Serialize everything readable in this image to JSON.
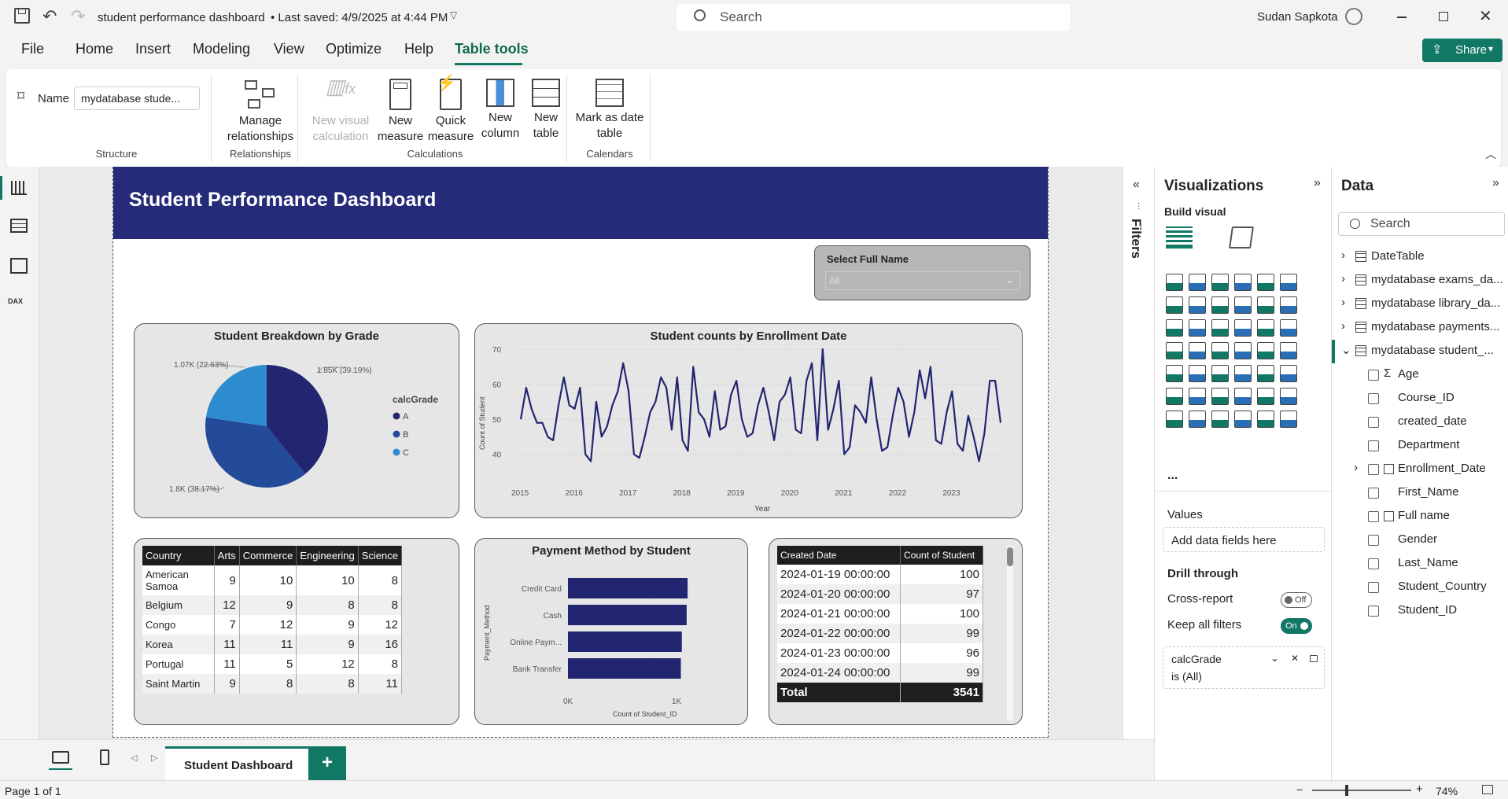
{
  "titlebar": {
    "file_title": "student performance dashboard",
    "saved_text": "• Last saved: 4/9/2025 at 4:44 PM",
    "search_placeholder": "Search",
    "user_name": "Sudan Sapkota",
    "share_label": "Share"
  },
  "menu": {
    "items": [
      "File",
      "Home",
      "Insert",
      "Modeling",
      "View",
      "Optimize",
      "Help",
      "Table tools"
    ],
    "active": "Table tools"
  },
  "ribbon": {
    "name_label": "Name",
    "name_value": "mydatabase stude...",
    "structure_label": "Structure",
    "manage_relationships": "Manage relationships",
    "relationships_label": "Relationships",
    "new_visual_calculation": "New visual calculation",
    "new_measure": "New measure",
    "quick_measure": "Quick measure",
    "new_column": "New column",
    "new_table": "New table",
    "calculations_label": "Calculations",
    "mark_as_date_table": "Mark as date table",
    "calendars_label": "Calendars"
  },
  "report": {
    "header_title": "Student Performance Dashboard",
    "slicer_title": "Select Full Name",
    "slicer_value": "All"
  },
  "pie": {
    "title": "Student Breakdown by Grade",
    "legend_title": "calcGrade",
    "label_a": "1.85K (39.19%)",
    "label_b": "1.8K (38.17%)",
    "label_c": "1.07K (22.63%)",
    "legend": [
      "A",
      "B",
      "C"
    ]
  },
  "line": {
    "title": "Student counts by Enrollment Date",
    "ylabel": "Count of Student",
    "xlabel": "Year",
    "yticks": [
      "70",
      "60",
      "50",
      "40"
    ],
    "xticks": [
      "2015",
      "2016",
      "2017",
      "2018",
      "2019",
      "2020",
      "2021",
      "2022",
      "2023"
    ]
  },
  "matrix": {
    "headers": [
      "Country",
      "Arts",
      "Commerce",
      "Engineering",
      "Science"
    ],
    "rows": [
      [
        "American Samoa",
        "9",
        "10",
        "10",
        "8"
      ],
      [
        "Belgium",
        "12",
        "9",
        "8",
        "8"
      ],
      [
        "Congo",
        "7",
        "12",
        "9",
        "12"
      ],
      [
        "Korea",
        "11",
        "11",
        "9",
        "16"
      ],
      [
        "Portugal",
        "11",
        "5",
        "12",
        "8"
      ],
      [
        "Saint Martin",
        "9",
        "8",
        "8",
        "11"
      ]
    ]
  },
  "bar": {
    "title": "Payment Method by Student",
    "ylabel": "Payment_Method",
    "xlabel": "Count of Student_ID",
    "xticks": [
      "0K",
      "1K"
    ]
  },
  "table": {
    "headers": [
      "Created Date",
      "Count of Student"
    ],
    "rows": [
      [
        "2024-01-19 00:00:00",
        "100"
      ],
      [
        "2024-01-20 00:00:00",
        "97"
      ],
      [
        "2024-01-21 00:00:00",
        "100"
      ],
      [
        "2024-01-22 00:00:00",
        "99"
      ],
      [
        "2024-01-23 00:00:00",
        "96"
      ],
      [
        "2024-01-24 00:00:00",
        "99"
      ]
    ],
    "total_label": "Total",
    "total_value": "3541"
  },
  "filters": {
    "label": "Filters"
  },
  "visualizations": {
    "title": "Visualizations",
    "build_visual": "Build visual",
    "values_label": "Values",
    "add_fields": "Add data fields here",
    "drill_through": "Drill through",
    "cross_report": "Cross-report",
    "cross_report_state": "Off",
    "keep_all_filters": "Keep all filters",
    "keep_all_filters_state": "On",
    "filter_card_field": "calcGrade",
    "filter_card_value": "is (All)",
    "more": "..."
  },
  "data_pane": {
    "title": "Data",
    "search_placeholder": "Search",
    "tables": [
      "DateTable",
      "mydatabase exams_da...",
      "mydatabase library_da...",
      "mydatabase payments...",
      "mydatabase student_..."
    ],
    "fields": [
      "Age",
      "Course_ID",
      "created_date",
      "Department",
      "Enrollment_Date",
      "First_Name",
      "Full name",
      "Gender",
      "Last_Name",
      "Student_Country",
      "Student_ID"
    ]
  },
  "tabs": {
    "page_tab": "Student Dashboard",
    "add": "+"
  },
  "status": {
    "page_info": "Page 1 of 1",
    "zoom": "74%"
  },
  "chart_data": [
    {
      "type": "pie",
      "title": "Student Breakdown by Grade",
      "legend_title": "calcGrade",
      "categories": [
        "A",
        "B",
        "C"
      ],
      "values": [
        1850,
        1800,
        1070
      ],
      "percents": [
        39.19,
        38.17,
        22.63
      ],
      "colors": [
        "#222670",
        "#244a9a",
        "#2d8ccf"
      ]
    },
    {
      "type": "line",
      "title": "Student counts by Enrollment Date",
      "ylabel": "Count of Student",
      "xlabel": "Year",
      "ylim": [
        35,
        70
      ],
      "xlim": [
        2015,
        2023.9
      ],
      "color": "#222670",
      "x": [
        2015.0,
        2015.1,
        2015.2,
        2015.3,
        2015.4,
        2015.5,
        2015.6,
        2015.7,
        2015.8,
        2015.9,
        2016.0,
        2016.1,
        2016.2,
        2016.3,
        2016.4,
        2016.5,
        2016.6,
        2016.7,
        2016.8,
        2016.9,
        2017.0,
        2017.1,
        2017.2,
        2017.3,
        2017.4,
        2017.5,
        2017.6,
        2017.7,
        2017.8,
        2017.9,
        2018.0,
        2018.1,
        2018.2,
        2018.3,
        2018.4,
        2018.5,
        2018.6,
        2018.7,
        2018.8,
        2018.9,
        2019.0,
        2019.1,
        2019.2,
        2019.3,
        2019.4,
        2019.5,
        2019.6,
        2019.7,
        2019.8,
        2019.9,
        2020.0,
        2020.1,
        2020.2,
        2020.3,
        2020.4,
        2020.5,
        2020.6,
        2020.7,
        2020.8,
        2020.9,
        2021.0,
        2021.1,
        2021.2,
        2021.3,
        2021.4,
        2021.5,
        2021.6,
        2021.7,
        2021.8,
        2021.9,
        2022.0,
        2022.1,
        2022.2,
        2022.3,
        2022.4,
        2022.5,
        2022.6,
        2022.7,
        2022.8,
        2022.9,
        2023.0,
        2023.1,
        2023.2,
        2023.3,
        2023.4,
        2023.5,
        2023.6,
        2023.7,
        2023.8,
        2023.9
      ],
      "y": [
        50,
        59,
        53,
        49,
        49,
        45,
        44,
        54,
        62,
        54,
        53,
        59,
        40,
        38,
        55,
        45,
        48,
        54,
        58,
        66,
        58,
        40,
        39,
        45,
        52,
        55,
        62,
        59,
        47,
        62,
        44,
        41,
        65,
        52,
        50,
        45,
        58,
        47,
        48,
        57,
        61,
        50,
        45,
        46,
        54,
        59,
        52,
        44,
        55,
        57,
        62,
        47,
        46,
        61,
        66,
        44,
        70,
        47,
        53,
        61,
        40,
        42,
        54,
        52,
        49,
        62,
        50,
        41,
        42,
        51,
        59,
        55,
        45,
        52,
        64,
        56,
        65,
        44,
        43,
        52,
        58,
        43,
        41,
        51,
        45,
        38,
        46,
        61,
        61,
        49
      ]
    },
    {
      "type": "bar",
      "title": "Payment Method by Student",
      "ylabel": "Payment_Method",
      "xlabel": "Count of Student_ID",
      "categories": [
        "Credit Card",
        "Cash",
        "Online Paym...",
        "Bank Transfer"
      ],
      "values": [
        1240,
        1230,
        1180,
        1170
      ],
      "xlim": [
        0,
        1500
      ],
      "color": "#222670"
    },
    {
      "type": "table",
      "title": "",
      "columns": [
        "Country",
        "Arts",
        "Commerce",
        "Engineering",
        "Science"
      ],
      "rows": [
        [
          "American Samoa",
          9,
          10,
          10,
          8
        ],
        [
          "Belgium",
          12,
          9,
          8,
          8
        ],
        [
          "Congo",
          7,
          12,
          9,
          12
        ],
        [
          "Korea",
          11,
          11,
          9,
          16
        ],
        [
          "Portugal",
          11,
          5,
          12,
          8
        ],
        [
          "Saint Martin",
          9,
          8,
          8,
          11
        ]
      ]
    },
    {
      "type": "table",
      "title": "",
      "columns": [
        "Created Date",
        "Count of Student"
      ],
      "rows": [
        [
          "2024-01-19 00:00:00",
          100
        ],
        [
          "2024-01-20 00:00:00",
          97
        ],
        [
          "2024-01-21 00:00:00",
          100
        ],
        [
          "2024-01-22 00:00:00",
          99
        ],
        [
          "2024-01-23 00:00:00",
          96
        ],
        [
          "2024-01-24 00:00:00",
          99
        ]
      ],
      "total": 3541
    }
  ]
}
